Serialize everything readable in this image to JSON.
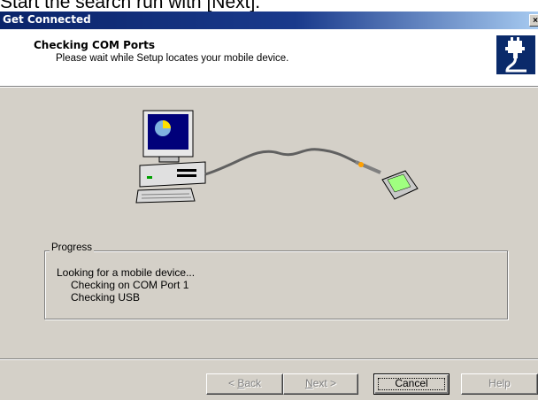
{
  "caption": "Start the search run with [Next].",
  "window": {
    "title": "Get Connected",
    "close_glyph": "×"
  },
  "header": {
    "title": "Checking COM Ports",
    "subtitle": "Please wait while Setup locates your mobile device.",
    "icon": "device-connect-icon"
  },
  "progress": {
    "legend": "Progress",
    "lines": [
      "Looking for a mobile device...",
      "Checking on COM Port 1",
      "Checking USB"
    ]
  },
  "buttons": {
    "back": {
      "pre": "< ",
      "acc": "B",
      "post": "ack"
    },
    "next": {
      "acc": "N",
      "post": "ext >"
    },
    "cancel": "Cancel",
    "help": "Help"
  }
}
